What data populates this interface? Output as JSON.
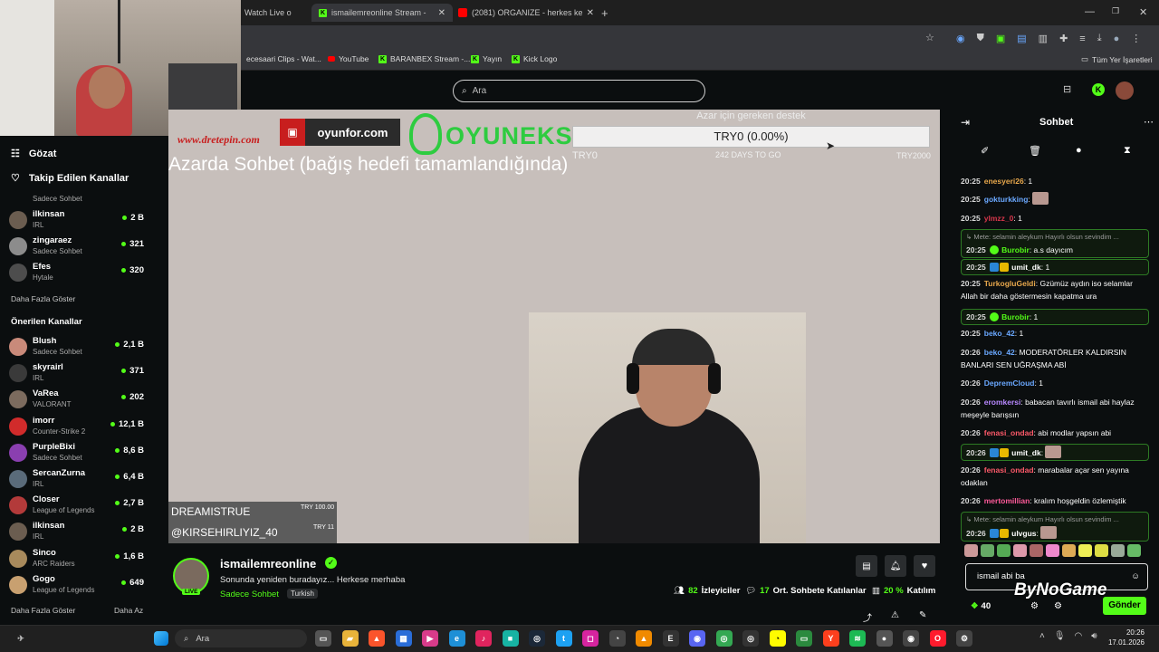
{
  "browser": {
    "tabs": [
      {
        "label": "Watch Live o"
      },
      {
        "label": "ismailemreonline Stream - "
      },
      {
        "label": "(2081) ORGANIZE - herkes ken"
      }
    ],
    "bookmarks": [
      "ecesaari Clips - Wat...",
      "YouTube",
      "BARANBEX Stream -...",
      "Yayın",
      "Kick Logo"
    ],
    "all_bookmarks": "Tüm Yer İşaretleri"
  },
  "kick": {
    "search_placeholder": "Ara"
  },
  "sidebar": {
    "nav": [
      "Gözat",
      "Takip Edilen Kanallar"
    ],
    "followed_partial_category": "Sadece Sohbet",
    "followed": [
      {
        "name": "ilkinsan",
        "category": "IRL",
        "viewers": "2 B"
      },
      {
        "name": "zingaraez",
        "category": "Sadece Sohbet",
        "viewers": "321"
      },
      {
        "name": "Efes",
        "category": "Hytale",
        "viewers": "320"
      }
    ],
    "show_more": "Daha Fazla Göster",
    "recommended_title": "Önerilen Kanallar",
    "recommended": [
      {
        "name": "Blush",
        "category": "Sadece Sohbet",
        "viewers": "2,1 B",
        "color": "#c98a7a"
      },
      {
        "name": "skyrairl",
        "category": "IRL",
        "viewers": "371",
        "color": "#3a3a3a"
      },
      {
        "name": "VaRea",
        "category": "VALORANT",
        "viewers": "202",
        "color": "#7c6b5e"
      },
      {
        "name": "imorr",
        "category": "Counter-Strike 2",
        "viewers": "12,1 B",
        "color": "#d12b2b"
      },
      {
        "name": "PurpleBixi",
        "category": "Sadece Sohbet",
        "viewers": "8,6 B",
        "color": "#8a3fb0"
      },
      {
        "name": "SercanZurna",
        "category": "IRL",
        "viewers": "6,4 B",
        "color": "#5a6b7a"
      },
      {
        "name": "Closer",
        "category": "League of Legends",
        "viewers": "2,7 B",
        "color": "#b33a3a"
      },
      {
        "name": "ilkinsan",
        "category": "IRL",
        "viewers": "2 B",
        "color": "#6b5d50"
      },
      {
        "name": "Sinco",
        "category": "ARC Raiders",
        "viewers": "1,6 B",
        "color": "#a88a5c"
      },
      {
        "name": "Gogo",
        "category": "League of Legends",
        "viewers": "649",
        "color": "#c8a070"
      }
    ],
    "show_more2": "Daha Fazla Göster",
    "show_less": "Daha Az"
  },
  "overlay": {
    "dretepin": "www.dretepin.com",
    "oyunfor": "oyunfor.com",
    "oyuneks": "OYUNEKS",
    "goal_title": "Azar için gereken destek",
    "goal_value": "TRY0 (0.00%)",
    "goal_min": "TRY0",
    "goal_days": "242 DAYS TO GO",
    "goal_max": "TRY2000",
    "headline": "Azarda Sohbet (bağış hedefi tamamlandığında)",
    "donor1": "DREAMISTRUE",
    "donor1_amt": "TRY 100.00",
    "donor2": "@KIRSEHIRLIYIZ_40",
    "donor2_amt": "TRY 11"
  },
  "stream": {
    "channel": "ismailemreonline",
    "title": "Sonunda yeniden buradayız... Herkese merhaba",
    "category": "Sadece Sohbet",
    "language": "Turkish",
    "live": "LIVE",
    "viewers_num": "82",
    "viewers_label": "İzleyiciler",
    "chatters_num": "17",
    "chatters_label": "Ort. Sohbete Katılanlar",
    "rate_num": "20 %",
    "rate_label": "Katılım"
  },
  "chat": {
    "title": "Sohbet",
    "messages": [
      {
        "t": "20:25",
        "u": "enesyeri26",
        "c": "#e8a84c",
        "m": ": 1"
      },
      {
        "t": "20:25",
        "u": "gokturkking",
        "c": "#6aa8ff",
        "m": ":"
      },
      {
        "t": "20:25",
        "u": "ylmzz_0",
        "c": "#d6364b",
        "m": ": 1"
      },
      {
        "t": "20:25",
        "u": "Burobir",
        "c": "#53fc18",
        "m": ": a.s dayıcım",
        "reply": "↳ Mete: selamin aleykum Hayırlı olsun sevindim ..."
      },
      {
        "t": "20:25",
        "u": "umit_dk",
        "c": "#fff",
        "m": ": 1"
      },
      {
        "t": "20:25",
        "u": "TurkogluGeldi",
        "c": "#e8a84c",
        "m": ": Gzümüz aydın iso selamlar Allah bir daha göstermesin kapatma ura"
      },
      {
        "t": "20:25",
        "u": "Burobir",
        "c": "#53fc18",
        "m": ": 1"
      },
      {
        "t": "20:25",
        "u": "beko_42",
        "c": "#6aa8ff",
        "m": ": 1"
      },
      {
        "t": "20:26",
        "u": "beko_42",
        "c": "#6aa8ff",
        "m": ": MODERATÖRLER KALDIRSIN BANLARI SEN UĞRAŞMA ABİ"
      },
      {
        "t": "20:26",
        "u": "DepremCloud",
        "c": "#6aa8ff",
        "m": ": 1"
      },
      {
        "t": "20:26",
        "u": "eromkersi",
        "c": "#b888ff",
        "m": ": babacan tavırlı ismail abi haylaz meşeyle barışsın"
      },
      {
        "t": "20:26",
        "u": "fenasi_ondad",
        "c": "#ff5a6a",
        "m": ": abi modlar yapsın abi"
      },
      {
        "t": "20:26",
        "u": "umit_dk",
        "c": "#fff",
        "m": ":"
      },
      {
        "t": "20:26",
        "u": "fenasi_ondad",
        "c": "#ff5a6a",
        "m": ": marabalar açar sen yayına odaklan"
      },
      {
        "t": "20:26",
        "u": "mertomillian",
        "c": "#ff5a9a",
        "m": ": kralım hoşgeldin özlemiştik"
      },
      {
        "t": "20:26",
        "u": "ulvgus",
        "c": "#fff",
        "m": ":",
        "reply": "↳ Mete: selamin aleykum Hayırlı olsun sevindim ..."
      }
    ],
    "input_value": "ismail abi ba",
    "points": "40",
    "send": "Gönder",
    "watermark": "ByNoGame"
  },
  "taskbar": {
    "search": "Ara",
    "time": "20:26",
    "date": "17.01.2026"
  }
}
